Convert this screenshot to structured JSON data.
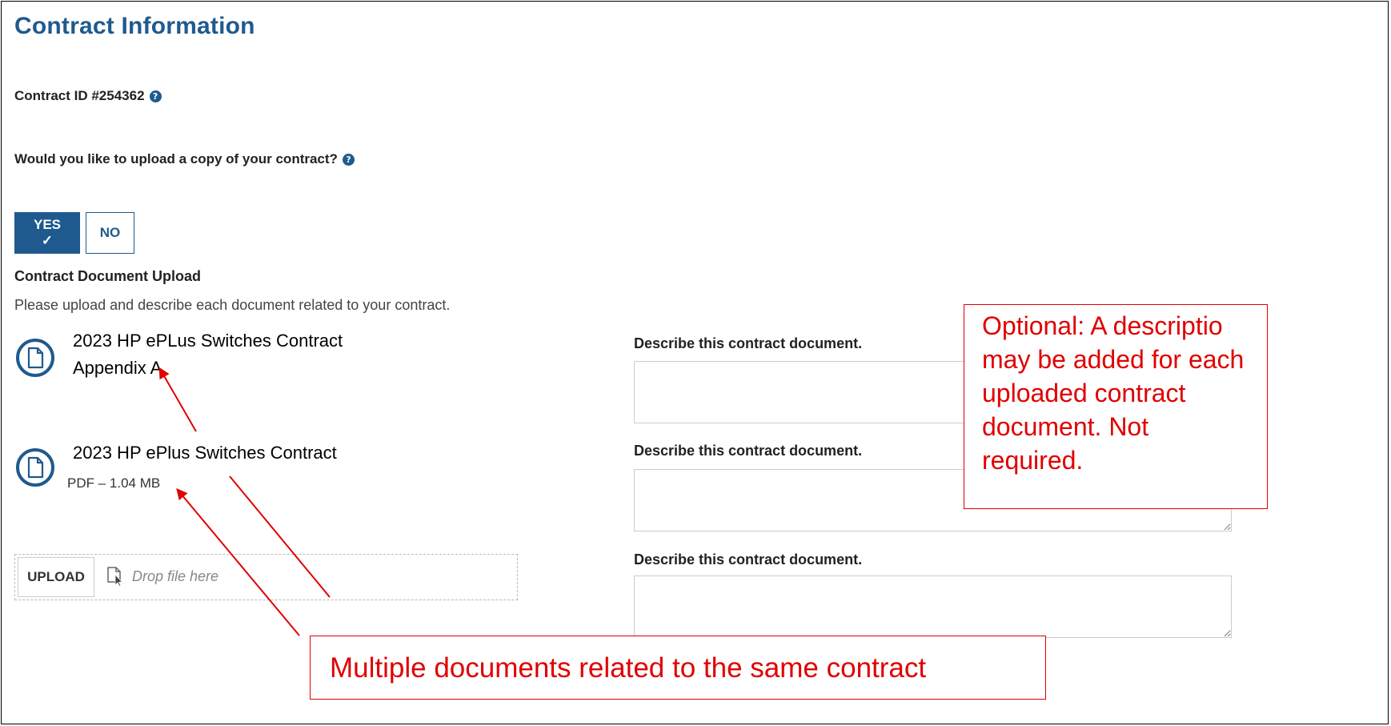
{
  "page": {
    "title": "Contract Information",
    "contract_id": "Contract ID #254362",
    "question": "Would you like to upload a copy of your contract?",
    "toggle": {
      "yes_label": "YES ✓",
      "no_label": "NO",
      "selected": "YES"
    }
  },
  "upload_section": {
    "heading": "Contract Document Upload",
    "instructions": "Please upload and describe each document related to your contract.",
    "documents": [
      {
        "name_line1": "2023 HP ePLus Switches Contract",
        "name_line2": "Appendix A",
        "meta": ""
      },
      {
        "name_line1": "2023 HP ePlus Switches Contract",
        "name_line2": "",
        "meta": "PDF – 1.04 MB"
      }
    ],
    "description_label": "Describe this contract document.",
    "upload_button": "UPLOAD",
    "drop_text": "Drop file here"
  },
  "annotations": {
    "right_callout": [
      "Optional:  A descriptio",
      "may be added for each",
      "uploaded contract",
      "document. Not",
      "required."
    ],
    "bottom_callout": "Multiple documents related to the same contract",
    "color": "#e00000"
  },
  "colors": {
    "brand": "#1f5a8e",
    "annotation": "#e00000"
  },
  "icons": {
    "help": "question-circle-icon",
    "document": "document-circle-icon",
    "drop": "file-cursor-icon"
  }
}
